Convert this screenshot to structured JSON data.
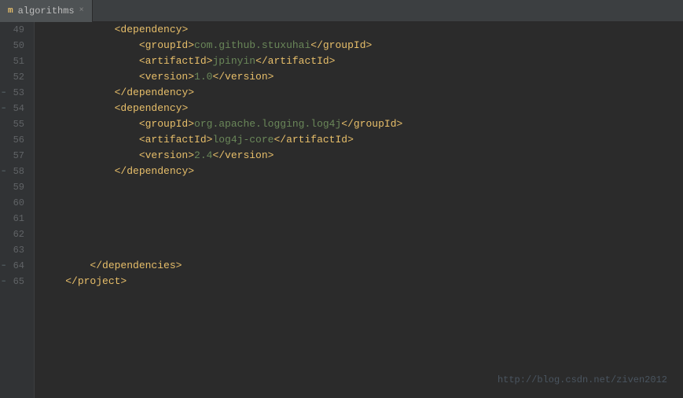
{
  "tab": {
    "icon": "m",
    "label": "algorithms",
    "close": "×"
  },
  "lines": [
    {
      "num": "49",
      "fold": null,
      "tokens": [
        {
          "t": "indent",
          "v": "            "
        },
        {
          "t": "tag",
          "v": "<dependency>"
        }
      ]
    },
    {
      "num": "50",
      "fold": null,
      "tokens": [
        {
          "t": "indent",
          "v": "                "
        },
        {
          "t": "tag",
          "v": "<groupId>"
        },
        {
          "t": "content",
          "v": "com.github.stuxuhai"
        },
        {
          "t": "tag",
          "v": "</groupId>"
        }
      ]
    },
    {
      "num": "51",
      "fold": null,
      "tokens": [
        {
          "t": "indent",
          "v": "                "
        },
        {
          "t": "tag",
          "v": "<artifactId>"
        },
        {
          "t": "content",
          "v": "jpinyin"
        },
        {
          "t": "tag",
          "v": "</artifactId>"
        }
      ]
    },
    {
      "num": "52",
      "fold": null,
      "tokens": [
        {
          "t": "indent",
          "v": "                "
        },
        {
          "t": "tag",
          "v": "<version>"
        },
        {
          "t": "content",
          "v": "1.0"
        },
        {
          "t": "tag",
          "v": "</version>"
        }
      ]
    },
    {
      "num": "53",
      "fold": "minus",
      "tokens": [
        {
          "t": "indent",
          "v": "            "
        },
        {
          "t": "tag",
          "v": "</dependency>"
        }
      ]
    },
    {
      "num": "54",
      "fold": "minus",
      "tokens": [
        {
          "t": "indent",
          "v": "            "
        },
        {
          "t": "tag",
          "v": "<dependency>"
        }
      ]
    },
    {
      "num": "55",
      "fold": null,
      "tokens": [
        {
          "t": "indent",
          "v": "                "
        },
        {
          "t": "tag",
          "v": "<groupId>"
        },
        {
          "t": "content",
          "v": "org.apache.logging.log4j"
        },
        {
          "t": "tag",
          "v": "</groupId>"
        }
      ]
    },
    {
      "num": "56",
      "fold": null,
      "tokens": [
        {
          "t": "indent",
          "v": "                "
        },
        {
          "t": "tag",
          "v": "<artifactId>"
        },
        {
          "t": "content",
          "v": "log4j-core"
        },
        {
          "t": "tag",
          "v": "</artifactId>"
        }
      ]
    },
    {
      "num": "57",
      "fold": null,
      "tokens": [
        {
          "t": "indent",
          "v": "                "
        },
        {
          "t": "tag",
          "v": "<version>"
        },
        {
          "t": "content",
          "v": "2.4"
        },
        {
          "t": "tag",
          "v": "</version>"
        }
      ]
    },
    {
      "num": "58",
      "fold": "minus",
      "tokens": [
        {
          "t": "indent",
          "v": "            "
        },
        {
          "t": "tag",
          "v": "</dependency>"
        }
      ]
    },
    {
      "num": "59",
      "fold": null,
      "tokens": []
    },
    {
      "num": "60",
      "fold": null,
      "tokens": []
    },
    {
      "num": "61",
      "fold": null,
      "tokens": []
    },
    {
      "num": "62",
      "fold": null,
      "tokens": []
    },
    {
      "num": "63",
      "fold": null,
      "tokens": []
    },
    {
      "num": "64",
      "fold": "minus",
      "tokens": [
        {
          "t": "indent",
          "v": "        "
        },
        {
          "t": "tag",
          "v": "</dependencies>"
        }
      ]
    },
    {
      "num": "65",
      "fold": "minus",
      "tokens": [
        {
          "t": "indent",
          "v": "    "
        },
        {
          "t": "tag",
          "v": "</project>"
        }
      ]
    }
  ],
  "watermark": "http://blog.csdn.net/ziven2012"
}
